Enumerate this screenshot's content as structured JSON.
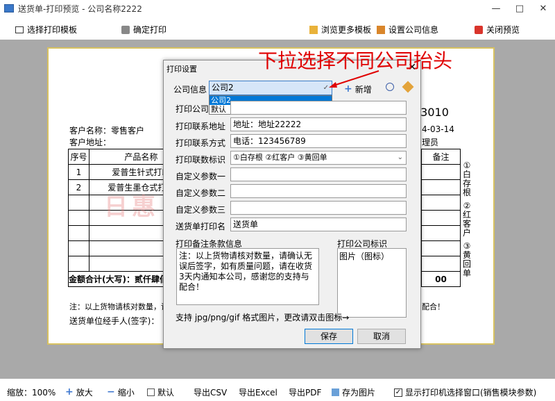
{
  "window": {
    "title": "送货单-打印预览 - 公司名称2222"
  },
  "toolbar": {
    "select_template": "选择打印模板",
    "confirm_print": "确定打印",
    "browse_templates": "浏览更多模板",
    "company_info": "设置公司信息",
    "close_preview": "关闭预览"
  },
  "doc": {
    "number": "03010",
    "customer_name": "客户名称：零售客户",
    "customer_address": "客户地址：",
    "date": "4-03-14",
    "staff": "理员",
    "headers": [
      "序号",
      "产品名称",
      "备注"
    ],
    "rows": [
      [
        "1",
        "爱普生针式打印"
      ],
      [
        "2",
        "爱普生墨仓式打印"
      ]
    ],
    "total_label": "金额合计(大写)：贰仟肆佰",
    "total_right": "00",
    "footnote": "注：以上货物请核对数量，请",
    "footnote_right": "配合！",
    "signer": "送货单位经手人(签字)：",
    "side_labels": [
      "①白存根",
      "②红客户",
      "③黄回单"
    ],
    "watermark": "日惠 货单管系统"
  },
  "dialog": {
    "title": "打印设置",
    "company_label": "公司信息",
    "company_value": "公司2",
    "dropdown_options": [
      "公司2",
      "默认"
    ],
    "new_label": "新增",
    "print_company_label": "打印公司",
    "addr_label": "打印联系地址",
    "addr_value": "地址：地址22222",
    "contact_label": "打印联系方式",
    "contact_value": "电话：123456789",
    "mark_label": "打印联数标识",
    "mark_value": "①白存根 ②红客户 ③黄回单",
    "custom1_label": "自定义参数一",
    "custom2_label": "自定义参数二",
    "custom3_label": "自定义参数三",
    "print_name_label": "送货单打印名",
    "print_name_value": "送货单",
    "remark_label": "打印备注条款信息",
    "remark_value": "注：以上货物请核对数量，请确认无误后签字，如有质量问题，请在收货3天内通知本公司，感谢您的支持与配合！",
    "logo_label": "打印公司标识",
    "logo_placeholder": "图片（图标）",
    "hint": "支持 jpg/png/gif 格式图片，更改请双击图标→",
    "save": "保存",
    "cancel": "取消"
  },
  "annotation": "下拉选择不同公司抬头",
  "statusbar": {
    "zoom": "缩放：100%",
    "zoom_in": "放大",
    "zoom_out": "缩小",
    "default": "默认",
    "export_csv": "导出CSV",
    "export_excel": "导出Excel",
    "export_pdf": "导出PDF",
    "save_image": "存为图片",
    "show_printer": "显示打印机选择窗口(销售模块参数)"
  }
}
